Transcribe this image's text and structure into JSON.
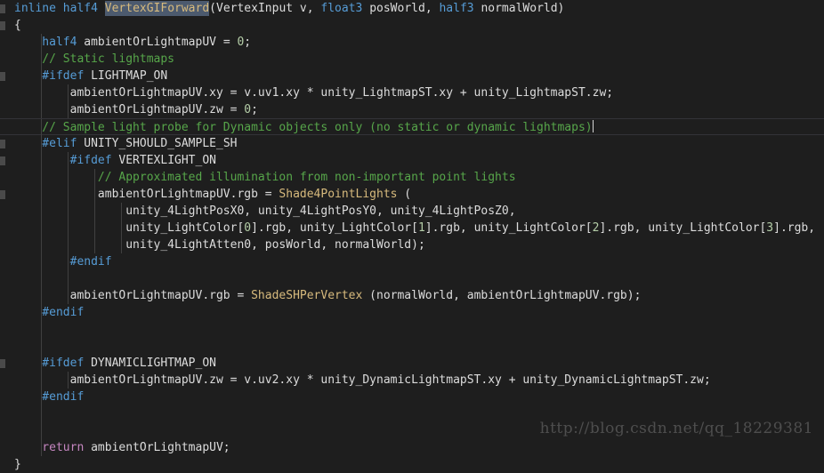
{
  "editor": {
    "language": "HLSL / ShaderLab",
    "theme": "dark",
    "background_color": "#1e1e1e",
    "foreground_color": "#dcdcdc",
    "current_line_index": 7,
    "selection_text": "VertexGIForward",
    "colors": {
      "keyword": "#569cd6",
      "preprocessor": "#569cd6",
      "comment": "#57a64a",
      "function": "#d7ba7d",
      "identifier": "#dcdcdc",
      "number": "#b5cea8",
      "control": "#c586c0",
      "selection": "#4c5a6e",
      "indent_guide": "#404040",
      "fold_marker": "#4a4a4a",
      "current_line_border": "#333338"
    }
  },
  "watermark": {
    "text": "http://blog.csdn.net/qq_18229381"
  },
  "code_lines": [
    {
      "n": 1,
      "fold": true,
      "guides": [],
      "tokens": [
        {
          "t": "inline ",
          "c": "kw"
        },
        {
          "t": "half4 ",
          "c": "kw"
        },
        {
          "t": "VertexGIForward",
          "c": "sel"
        },
        {
          "t": "(",
          "c": "brc"
        },
        {
          "t": "VertexInput v, ",
          "c": "id"
        },
        {
          "t": "float3 ",
          "c": "kw"
        },
        {
          "t": "posWorld, ",
          "c": "id"
        },
        {
          "t": "half3 ",
          "c": "kw"
        },
        {
          "t": "normalWorld)",
          "c": "id"
        }
      ]
    },
    {
      "n": 2,
      "fold": true,
      "guides": [],
      "tokens": [
        {
          "t": "{",
          "c": "brc"
        }
      ]
    },
    {
      "n": 3,
      "fold": false,
      "guides": [
        30
      ],
      "tokens": [
        {
          "t": "    half4 ",
          "c": "kw"
        },
        {
          "t": "ambientOrLightmapUV = ",
          "c": "id"
        },
        {
          "t": "0",
          "c": "num"
        },
        {
          "t": ";",
          "c": "id"
        }
      ]
    },
    {
      "n": 4,
      "fold": false,
      "guides": [
        30
      ],
      "tokens": [
        {
          "t": "    // Static lightmaps",
          "c": "cmt"
        }
      ]
    },
    {
      "n": 5,
      "fold": true,
      "guides": [
        30
      ],
      "tokens": [
        {
          "t": "    #ifdef ",
          "c": "pre"
        },
        {
          "t": "LIGHTMAP_ON",
          "c": "id"
        }
      ]
    },
    {
      "n": 6,
      "fold": false,
      "guides": [
        30,
        60
      ],
      "tokens": [
        {
          "t": "        ambientOrLightmapUV.xy = v.uv1.xy * unity_LightmapST.xy + unity_LightmapST.zw;",
          "c": "id"
        }
      ]
    },
    {
      "n": 7,
      "fold": false,
      "guides": [
        30,
        60
      ],
      "tokens": [
        {
          "t": "        ambientOrLightmapUV.zw = ",
          "c": "id"
        },
        {
          "t": "0",
          "c": "num"
        },
        {
          "t": ";",
          "c": "id"
        }
      ]
    },
    {
      "n": 8,
      "fold": false,
      "current": true,
      "caret": true,
      "guides": [
        30
      ],
      "tokens": [
        {
          "t": "    // Sample light probe for Dynamic objects only (no static or dynamic lightmaps)",
          "c": "cmt"
        }
      ]
    },
    {
      "n": 9,
      "fold": true,
      "guides": [
        30
      ],
      "tokens": [
        {
          "t": "    #elif ",
          "c": "pre"
        },
        {
          "t": "UNITY_SHOULD_SAMPLE_SH",
          "c": "id"
        }
      ]
    },
    {
      "n": 10,
      "fold": true,
      "guides": [
        30,
        60
      ],
      "tokens": [
        {
          "t": "        #ifdef ",
          "c": "pre"
        },
        {
          "t": "VERTEXLIGHT_ON",
          "c": "id"
        }
      ]
    },
    {
      "n": 11,
      "fold": false,
      "guides": [
        30,
        60,
        90
      ],
      "tokens": [
        {
          "t": "            // Approximated illumination from non-important point lights",
          "c": "cmt"
        }
      ]
    },
    {
      "n": 12,
      "fold": true,
      "guides": [
        30,
        60,
        90
      ],
      "tokens": [
        {
          "t": "            ambientOrLightmapUV.rgb = ",
          "c": "id"
        },
        {
          "t": "Shade4PointLights",
          "c": "fn"
        },
        {
          "t": " (",
          "c": "id"
        }
      ]
    },
    {
      "n": 13,
      "fold": false,
      "guides": [
        30,
        60,
        90,
        120
      ],
      "tokens": [
        {
          "t": "                unity_4LightPosX0, unity_4LightPosY0, unity_4LightPosZ0,",
          "c": "id"
        }
      ]
    },
    {
      "n": 14,
      "fold": false,
      "guides": [
        30,
        60,
        90,
        120
      ],
      "tokens": [
        {
          "t": "                unity_LightColor[",
          "c": "id"
        },
        {
          "t": "0",
          "c": "num"
        },
        {
          "t": "].rgb, unity_LightColor[",
          "c": "id"
        },
        {
          "t": "1",
          "c": "num"
        },
        {
          "t": "].rgb, unity_LightColor[",
          "c": "id"
        },
        {
          "t": "2",
          "c": "num"
        },
        {
          "t": "].rgb, unity_LightColor[",
          "c": "id"
        },
        {
          "t": "3",
          "c": "num"
        },
        {
          "t": "].rgb,",
          "c": "id"
        }
      ]
    },
    {
      "n": 15,
      "fold": false,
      "guides": [
        30,
        60,
        90,
        120
      ],
      "tokens": [
        {
          "t": "                unity_4LightAtten0, posWorld, normalWorld);",
          "c": "id"
        }
      ]
    },
    {
      "n": 16,
      "fold": false,
      "guides": [
        30,
        60
      ],
      "tokens": [
        {
          "t": "        #endif",
          "c": "pre"
        }
      ]
    },
    {
      "n": 17,
      "fold": false,
      "guides": [
        30,
        60
      ],
      "tokens": [
        {
          "t": "",
          "c": "id"
        }
      ]
    },
    {
      "n": 18,
      "fold": false,
      "guides": [
        30,
        60
      ],
      "tokens": [
        {
          "t": "        ambientOrLightmapUV.rgb = ",
          "c": "id"
        },
        {
          "t": "ShadeSHPerVertex",
          "c": "fn"
        },
        {
          "t": " (normalWorld, ambientOrLightmapUV.rgb);",
          "c": "id"
        }
      ]
    },
    {
      "n": 19,
      "fold": false,
      "guides": [
        30
      ],
      "tokens": [
        {
          "t": "    #endif",
          "c": "pre"
        }
      ]
    },
    {
      "n": 20,
      "fold": false,
      "guides": [
        30
      ],
      "tokens": [
        {
          "t": "",
          "c": "id"
        }
      ]
    },
    {
      "n": 21,
      "fold": false,
      "guides": [
        30
      ],
      "tokens": [
        {
          "t": "",
          "c": "id"
        }
      ]
    },
    {
      "n": 22,
      "fold": true,
      "guides": [
        30
      ],
      "tokens": [
        {
          "t": "    #ifdef ",
          "c": "pre"
        },
        {
          "t": "DYNAMICLIGHTMAP_ON",
          "c": "id"
        }
      ]
    },
    {
      "n": 23,
      "fold": false,
      "guides": [
        30,
        60
      ],
      "tokens": [
        {
          "t": "        ambientOrLightmapUV.zw = v.uv2.xy * unity_DynamicLightmapST.xy + unity_DynamicLightmapST.zw;",
          "c": "id"
        }
      ]
    },
    {
      "n": 24,
      "fold": false,
      "guides": [
        30
      ],
      "tokens": [
        {
          "t": "    #endif",
          "c": "pre"
        }
      ]
    },
    {
      "n": 25,
      "fold": false,
      "guides": [
        30
      ],
      "tokens": [
        {
          "t": "",
          "c": "id"
        }
      ]
    },
    {
      "n": 26,
      "fold": false,
      "guides": [
        30
      ],
      "tokens": [
        {
          "t": "",
          "c": "id"
        }
      ]
    },
    {
      "n": 27,
      "fold": false,
      "guides": [
        30
      ],
      "tokens": [
        {
          "t": "    return ",
          "c": "ctl"
        },
        {
          "t": "ambientOrLightmapUV;",
          "c": "id"
        }
      ]
    },
    {
      "n": 28,
      "fold": false,
      "guides": [],
      "tokens": [
        {
          "t": "}",
          "c": "brc"
        }
      ]
    }
  ]
}
